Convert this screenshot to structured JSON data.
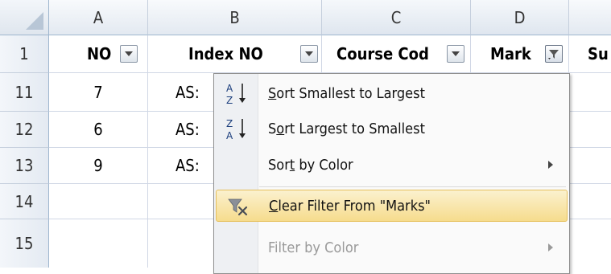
{
  "columns": [
    "A",
    "B",
    "C",
    "D"
  ],
  "rows": [
    "1",
    "11",
    "12",
    "13",
    "14",
    "15"
  ],
  "header_row": {
    "a": "NO",
    "b": "Index NO",
    "c": "Course Cod",
    "d": "Mark",
    "e": "Su"
  },
  "data_rows": [
    {
      "no": "7",
      "index": "AS:"
    },
    {
      "no": "6",
      "index": "AS:"
    },
    {
      "no": "9",
      "index": "AS:"
    }
  ],
  "menu": {
    "sort_asc": {
      "pre": "",
      "u": "S",
      "post": "ort Smallest to Largest"
    },
    "sort_desc": {
      "pre": "S",
      "u": "o",
      "post": "rt Largest to Smallest"
    },
    "sort_color": {
      "pre": "Sor",
      "u": "t",
      "post": " by Color"
    },
    "clear_filter": {
      "pre": "",
      "u": "C",
      "post": "lear Filter From \"Marks\""
    },
    "filter_color": "Filter by Color"
  },
  "icons": {
    "sort_asc": "sort-a-to-z-icon",
    "sort_desc": "sort-z-to-a-icon",
    "clear_filter": "clear-filter-icon"
  }
}
